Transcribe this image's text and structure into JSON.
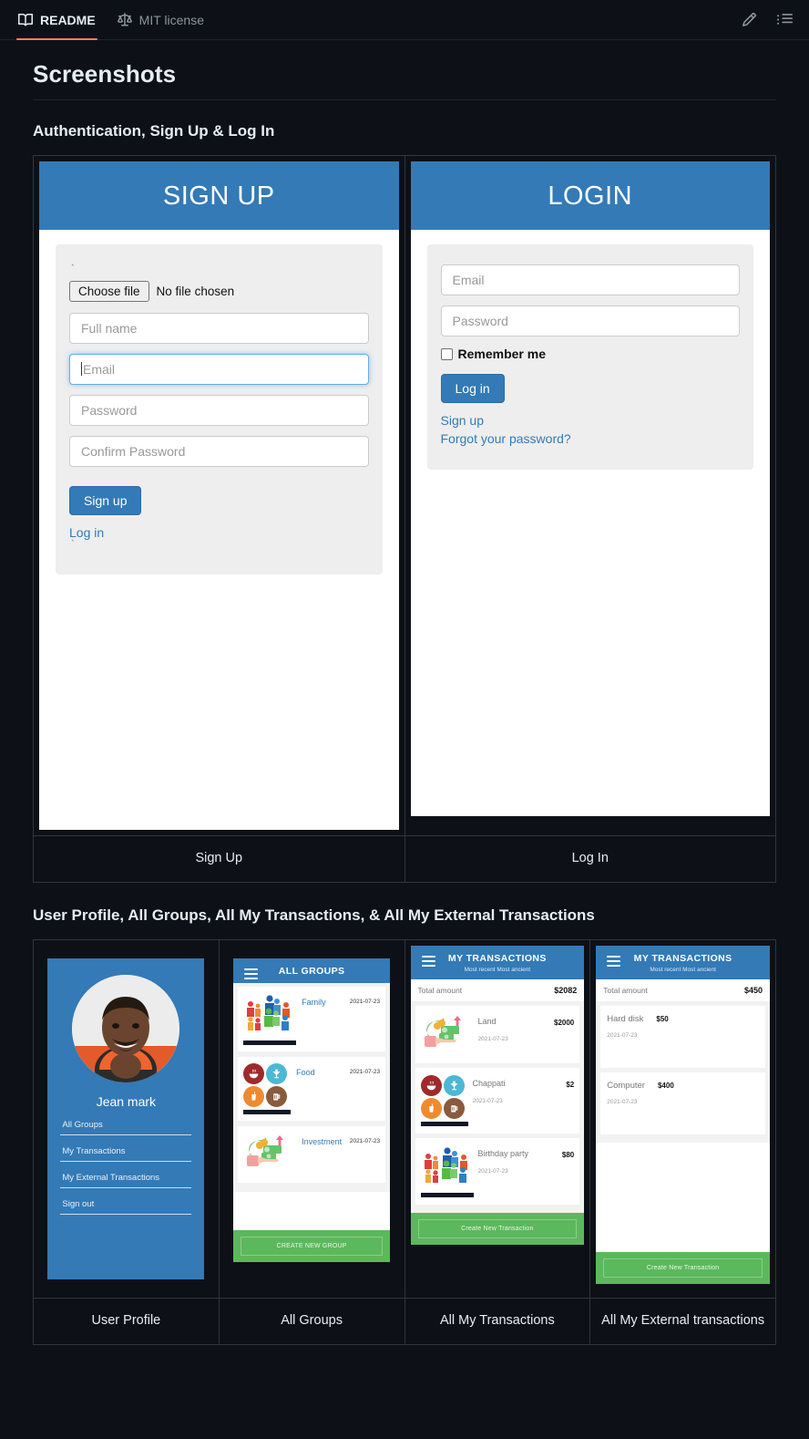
{
  "filebar": {
    "tabs": [
      {
        "label": "README",
        "icon": "book-icon",
        "active": true
      },
      {
        "label": "MIT license",
        "icon": "scale-icon",
        "active": false
      }
    ],
    "actions": [
      {
        "name": "edit-icon",
        "label": "Edit"
      },
      {
        "name": "outline-icon",
        "label": "Outline"
      }
    ]
  },
  "readme": {
    "title": "Screenshots",
    "sections": [
      {
        "heading": "Authentication, Sign Up & Log In",
        "captions": [
          "Sign Up",
          "Log In"
        ]
      },
      {
        "heading": "User Profile, All Groups, All My Transactions, & All My External Transactions",
        "captions": [
          "User Profile",
          "All Groups",
          "All My Transactions",
          "All My External transactions"
        ]
      }
    ]
  },
  "signup": {
    "header": "SIGN UP",
    "tick": "`",
    "tick2": "`",
    "file_button": "Choose file",
    "file_status": "No file chosen",
    "fields": [
      {
        "placeholder": "Full name",
        "focused": false
      },
      {
        "placeholder": "Email",
        "focused": true
      },
      {
        "placeholder": "Password",
        "focused": false
      },
      {
        "placeholder": "Confirm Password",
        "focused": false
      }
    ],
    "submit": "Sign up",
    "alt_link": "Log in"
  },
  "login": {
    "header": "LOGIN",
    "fields": [
      {
        "placeholder": "Email"
      },
      {
        "placeholder": "Password"
      }
    ],
    "remember_label": "Remember me",
    "submit": "Log in",
    "links": [
      "Sign up",
      "Forgot your password?"
    ]
  },
  "profile": {
    "avatar": "user-photo",
    "name": "Jean mark",
    "links": [
      "All Groups",
      "My Transactions",
      "My External Transactions",
      "Sign out"
    ]
  },
  "groups": {
    "title": "ALL GROUPS",
    "menu_icon": "hamburger-icon",
    "items": [
      {
        "name": "Family",
        "date": "2021-07-23",
        "icon": "family-people-icon"
      },
      {
        "name": "Food",
        "date": "2021-07-23",
        "icon": "food-icons"
      },
      {
        "name": "Investment",
        "date": "2021-07-23",
        "icon": "investment-money-icon"
      }
    ],
    "cta": "CREATE NEW GROUP"
  },
  "transactions": {
    "title": "MY TRANSACTIONS",
    "sort": "Most recent Most ancient",
    "total_label": "Total amount",
    "total_value": "$2082",
    "items": [
      {
        "name": "Land",
        "amount": "$2000",
        "date": "2021-07-23",
        "icon": "investment-money-icon"
      },
      {
        "name": "Chappati",
        "amount": "$2",
        "date": "2021-07-23",
        "icon": "food-icons"
      },
      {
        "name": "Birthday party",
        "amount": "$80",
        "date": "2021-07-23",
        "icon": "family-people-icon"
      }
    ],
    "cta": "Create New Transaction"
  },
  "external": {
    "title": "MY TRANSACTIONS",
    "sort": "Most recent Most ancient",
    "total_label": "Total amount",
    "total_value": "$450",
    "items": [
      {
        "name": "Hard disk",
        "amount": "$50",
        "date": "2021-07-23"
      },
      {
        "name": "Computer",
        "amount": "$400",
        "date": "2021-07-23"
      }
    ],
    "cta": "Create New Transaction"
  },
  "colors": {
    "page_bg": "#0d1117",
    "accent_blue": "#337ab7",
    "link_blue": "#337ab7",
    "cta_green": "#5cb85c",
    "tab_underline": "#f78166",
    "panel_gray": "#eeeeee"
  }
}
